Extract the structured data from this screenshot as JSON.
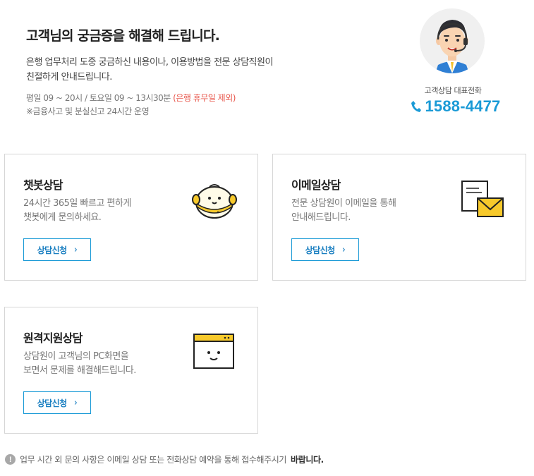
{
  "hero": {
    "title": "고객님의 궁금증을 해결해 드립니다.",
    "desc_line1": "은행 업무처리 도중 궁금하신 내용이나, 이용방법을 전문 상담직원이",
    "desc_line2": "친절하게 안내드립니다.",
    "hours": "평일 09 ~ 20시 / 토요일 09 ~ 13시30분",
    "hours_note": "(은행 휴무일 제외)",
    "emergency": "※금융사고 및 분실신고 24시간 운영"
  },
  "contact": {
    "label": "고객상담 대표전화",
    "phone": "1588-4477",
    "phone_icon": "phone-icon"
  },
  "cards": [
    {
      "title": "챗봇상담",
      "desc_line1": "24시간 365일 빠르고 편하게",
      "desc_line2": "챗봇에게 문의하세요.",
      "button": "상담신청",
      "icon": "chatbot-icon"
    },
    {
      "title": "이메일상담",
      "desc_line1": "전문 상담원이 이메일을 통해",
      "desc_line2": "안내해드립니다.",
      "button": "상담신청",
      "icon": "email-icon"
    },
    {
      "title": "원격지원상담",
      "desc_line1": "상담원이 고객님의 PC화면을",
      "desc_line2": "보면서 문제를 해결해드립니다.",
      "button": "상담신청",
      "icon": "remote-support-icon"
    }
  ],
  "footer": {
    "text": "업무 시간 외 문의 사항은 이메일 상담 또는 전화상담 예약을 통해 접수해주시기",
    "emphasis": "바랍니다."
  },
  "colors": {
    "accent": "#1a9ad6",
    "highlight": "#e8564b",
    "brand_yellow": "#f7c92b"
  }
}
